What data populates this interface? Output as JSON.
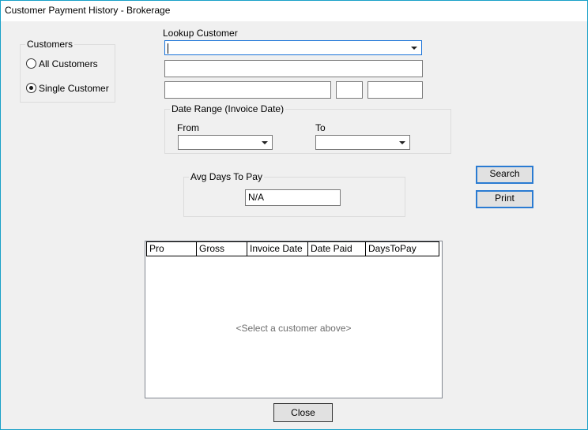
{
  "window": {
    "title": "Customer Payment History - Brokerage"
  },
  "customers_group": {
    "legend": "Customers",
    "options": [
      {
        "label": "All Customers",
        "selected": false
      },
      {
        "label": "Single Customer",
        "selected": true
      }
    ]
  },
  "lookup": {
    "label": "Lookup Customer",
    "value": "",
    "name_value": "",
    "city_value": "",
    "state_value": "",
    "zip_value": ""
  },
  "date_range": {
    "legend": "Date Range (Invoice Date)",
    "from_label": "From",
    "to_label": "To",
    "from_value": "",
    "to_value": ""
  },
  "avg_days": {
    "legend": "Avg Days To Pay",
    "value": "N/A"
  },
  "buttons": {
    "search": "Search",
    "print": "Print",
    "close": "Close"
  },
  "grid": {
    "columns": [
      "Pro",
      "Gross",
      "Invoice Date",
      "Date Paid",
      "DaysToPay"
    ],
    "empty_message": "<Select a customer above>"
  },
  "icons": {
    "dropdown": "chevron-down-icon",
    "radio": "radio-button-icon"
  },
  "colors": {
    "window_border": "#18a0c8",
    "focus_border": "#1a73d8",
    "default_button_border": "#2a7bd2",
    "background": "#f0f0f0"
  }
}
